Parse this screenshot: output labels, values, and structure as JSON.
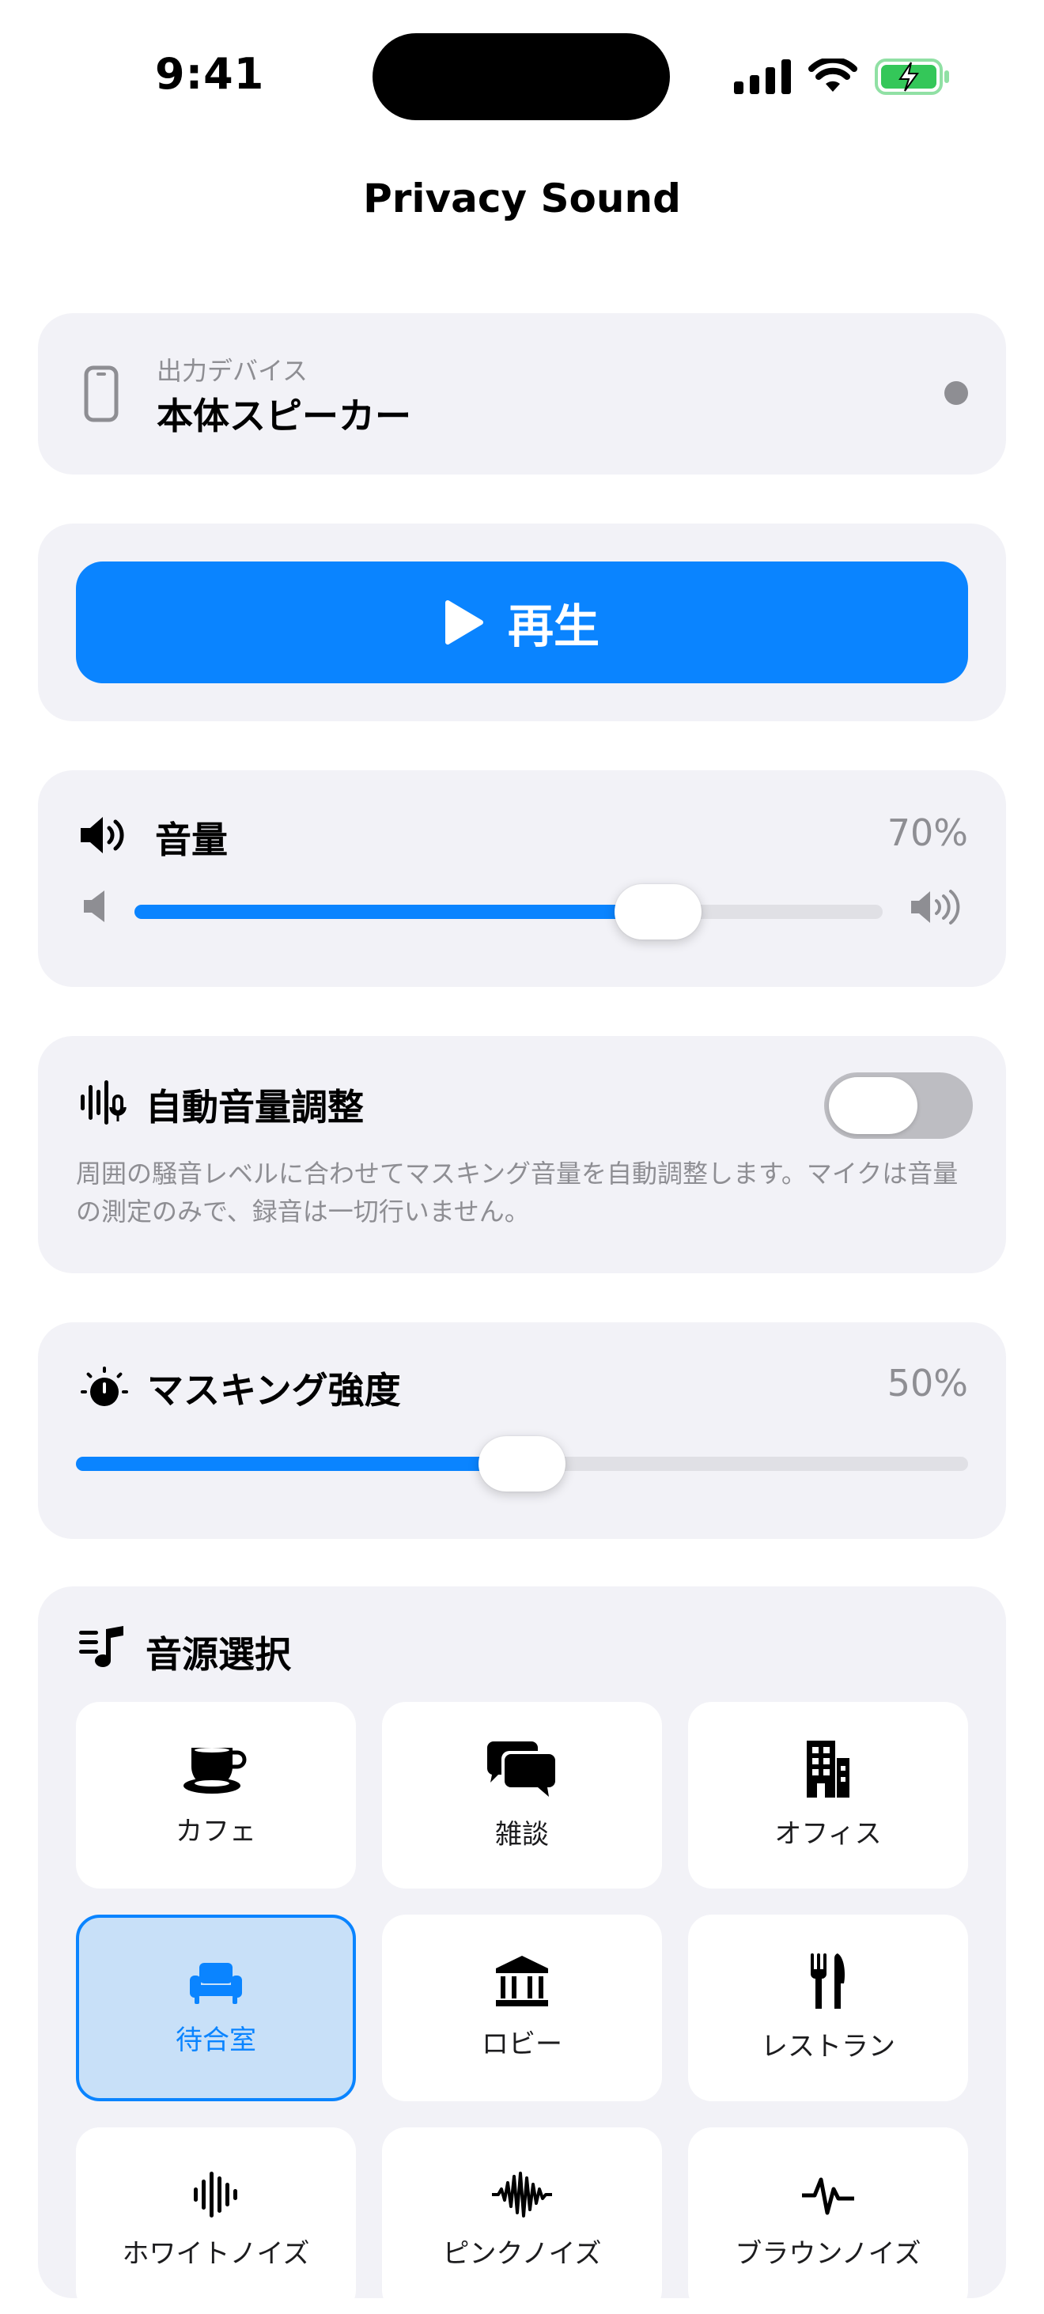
{
  "status_bar": {
    "time": "9:41"
  },
  "app": {
    "title": "Privacy Sound"
  },
  "output_device": {
    "label": "出力デバイス",
    "value": "本体スピーカー",
    "icon": "iphone-icon"
  },
  "playback": {
    "play_label": "再生",
    "icon": "play-icon"
  },
  "volume": {
    "title": "音量",
    "value_text": "70%",
    "level": 0.7,
    "icon": "speaker-wave-icon"
  },
  "auto_volume": {
    "title": "自動音量調整",
    "enabled": false,
    "description": "周囲の騒音レベルに合わせてマスキング音量を自動調整します。マイクは音量の測定のみで、録音は一切行いません。",
    "icon": "waveform-mic-icon"
  },
  "masking": {
    "title": "マスキング強度",
    "value_text": "50%",
    "level": 0.5,
    "icon": "dial-icon"
  },
  "sound_source": {
    "title": "音源選択",
    "icon": "music-list-icon",
    "items": [
      {
        "label": "カフェ",
        "icon": "coffee-cup-icon",
        "selected": false
      },
      {
        "label": "雑談",
        "icon": "chat-bubbles-icon",
        "selected": false
      },
      {
        "label": "オフィス",
        "icon": "building-icon",
        "selected": false
      },
      {
        "label": "待合室",
        "icon": "sofa-icon",
        "selected": true
      },
      {
        "label": "ロビー",
        "icon": "bank-icon",
        "selected": false
      },
      {
        "label": "レストラン",
        "icon": "fork-knife-icon",
        "selected": false
      },
      {
        "label": "ホワイトノイズ",
        "icon": "waveform-icon",
        "selected": false
      },
      {
        "label": "ピンクノイズ",
        "icon": "waveform-dense-icon",
        "selected": false
      },
      {
        "label": "ブラウンノイズ",
        "icon": "waveform-pulse-icon",
        "selected": false
      }
    ]
  },
  "colors": {
    "accent": "#0a84ff",
    "card_bg": "#f2f2f7",
    "secondary_text": "#8e8e93",
    "selected_tile_bg": "#c8e0f8",
    "battery_green": "#34c759"
  }
}
